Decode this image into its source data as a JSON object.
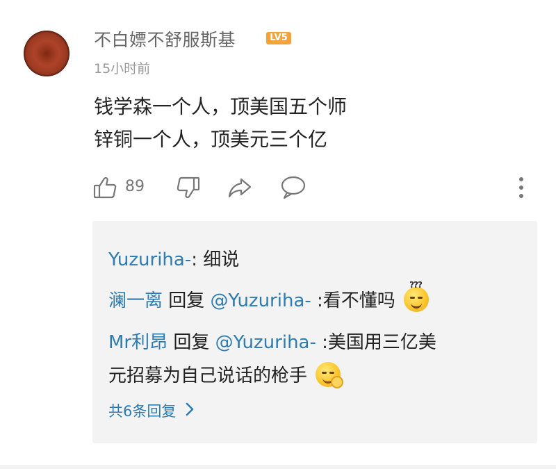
{
  "comment": {
    "username": "不白嫖不舒服斯基",
    "level": "LV5",
    "timestamp": "15小时前",
    "body_lines": [
      "钱学森一个人，顶美国五个师",
      "锌铜一个人，顶美元三个亿"
    ],
    "like_count": "89",
    "icons": [
      "thumbs-up-icon",
      "thumbs-down-icon",
      "share-icon",
      "comment-icon",
      "more-vertical-icon"
    ],
    "colors": {
      "link": "#2c7bb3",
      "level_badge": "#f3a33a",
      "reply_background": "#f3f3f3"
    }
  },
  "replies": {
    "items": [
      {
        "author": "Yuzuriha-",
        "separator": ": ",
        "text": "细说"
      },
      {
        "author": "澜一离",
        "reply_word": " 回复 ",
        "target": "@Yuzuriha-",
        "text": " :看不懂吗",
        "emoji": "confused-face-emoji"
      },
      {
        "author": "Mr利昂",
        "reply_word": " 回复 ",
        "target": "@Yuzuriha-",
        "text_line1": " :美国用三亿美",
        "text_line2": "元招募为自己说话的枪手",
        "emoji": "money-mouth-face-emoji"
      }
    ],
    "more_label": "共6条回复"
  }
}
